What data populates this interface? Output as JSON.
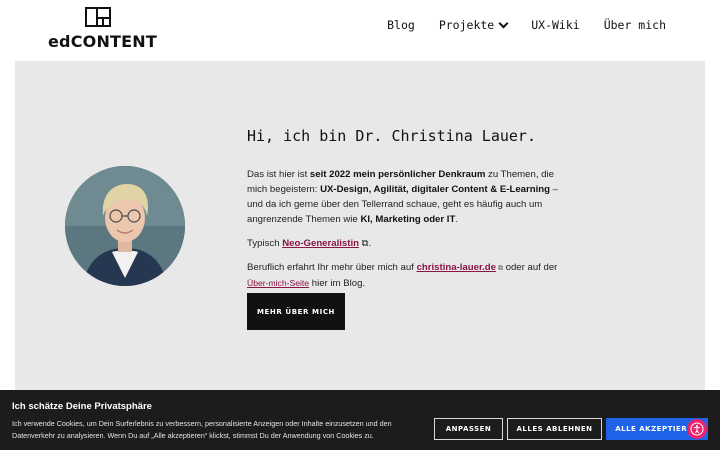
{
  "header": {
    "logo_text": "edCONTENT",
    "nav": [
      {
        "label": "Blog"
      },
      {
        "label": "Projekte",
        "has_dropdown": true
      },
      {
        "label": "UX-Wiki"
      },
      {
        "label": "Über mich"
      }
    ]
  },
  "hero": {
    "title": "Hi, ich bin Dr. Christina Lauer.",
    "p1": {
      "t1": "Das ist hier ist ",
      "b1": "seit 2022 mein persönlicher Denkraum",
      "t2": " zu Themen, die mich begeistern: ",
      "b2": "UX-Design, Agilität, digitaler Content & E-Learning",
      "t3": " – und da ich gerne über den Tellerrand schaue, geht es häufig auch um angrenzende Themen wie ",
      "b3": "KI, Marketing oder IT",
      "t4": "."
    },
    "p2": {
      "t1": "Typisch ",
      "link": "Neo-Generalistin",
      "t2": " ⧉."
    },
    "p3": {
      "t1": "Beruflich erfahrt Ihr mehr über mich auf ",
      "link1": "christina-lauer.de",
      "ext": " ⧉",
      "t2": " oder auf der ",
      "link2": "Über-mich-Seite",
      "t3": " hier im Blog."
    },
    "cta_label": "MEHR ÜBER MICH"
  },
  "cookie": {
    "title": "Ich schätze Deine Privatsphäre",
    "text": "Ich verwende Cookies, um Dein Surferlebnis zu verbessern, personalisierte Anzeigen oder Inhalte einzusetzen und den Datenverkehr zu analysieren. Wenn Du auf „Alle akzeptieren“ klickst, stimmst Du der Anwendung von Cookies zu.",
    "buttons": {
      "customize": "ANPASSEN",
      "reject": "ALLES ABLEHNEN",
      "accept": "ALLE AKZEPTIEREN"
    }
  },
  "colors": {
    "accent_link": "#8b1443",
    "primary_button": "#1e63e9",
    "banner_bg": "#1c1c1c",
    "hero_bg": "#e8e8e8",
    "accessibility": "#e8246f"
  },
  "icons": [
    "logo-mark-icon",
    "chevron-down-icon",
    "external-link-icon",
    "accessibility-icon"
  ]
}
